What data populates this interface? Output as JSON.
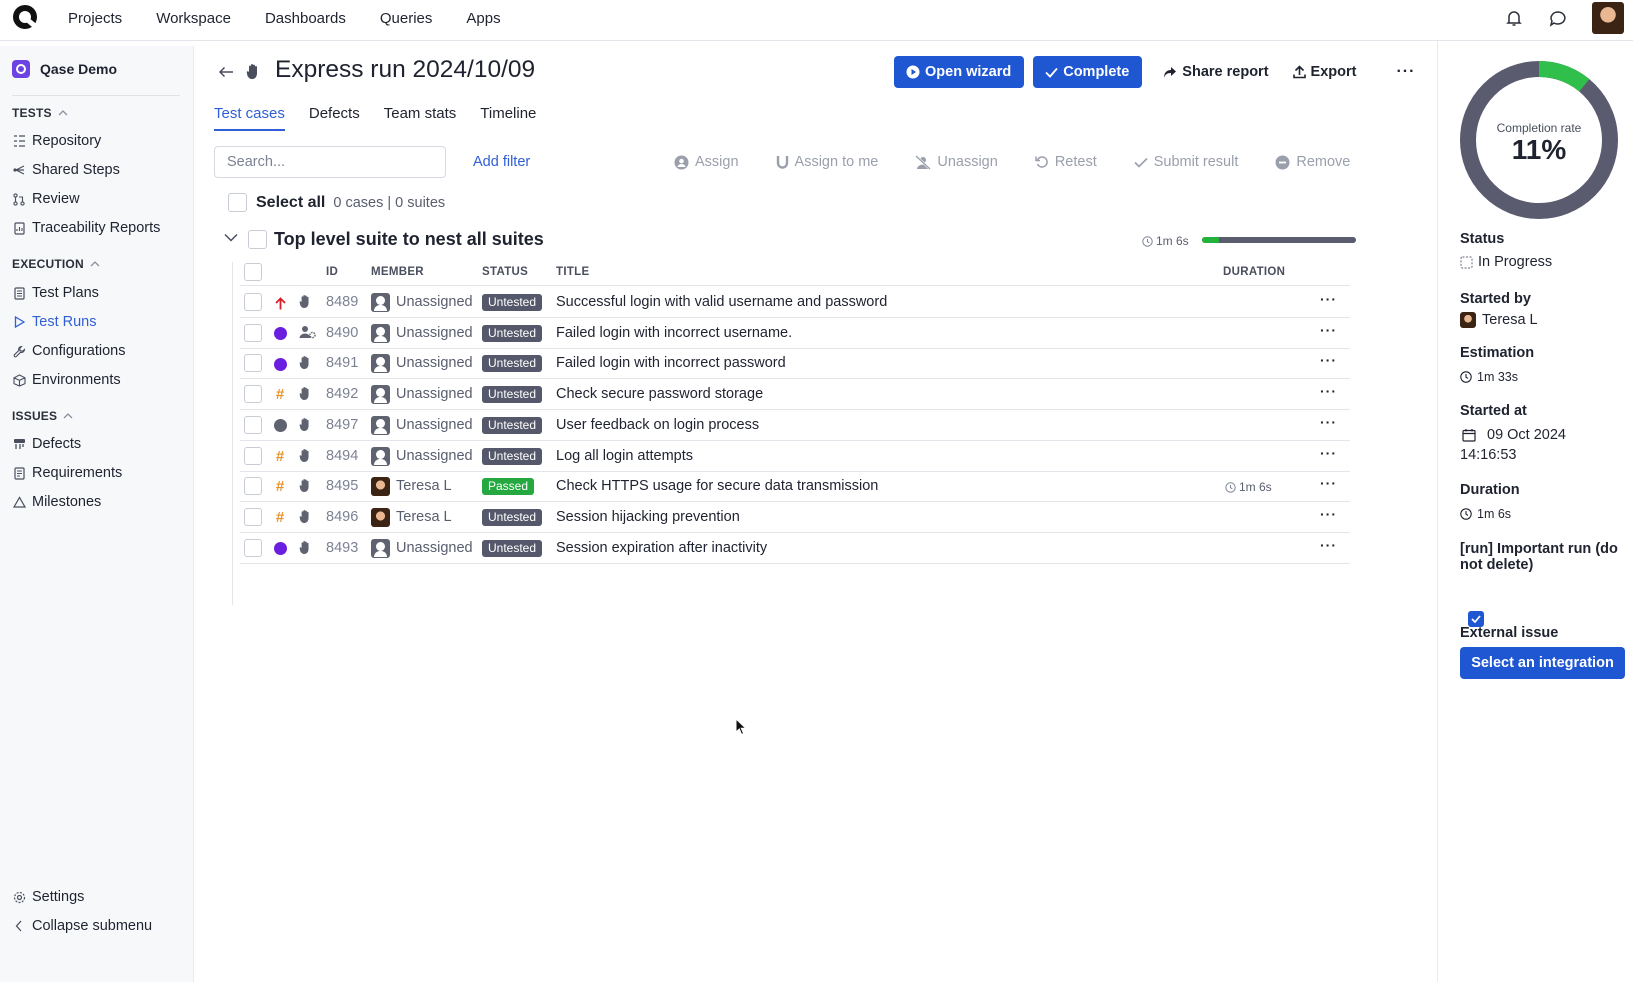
{
  "topnav": {
    "items": [
      "Projects",
      "Workspace",
      "Dashboards",
      "Queries",
      "Apps"
    ]
  },
  "sidebar": {
    "project": "Qase Demo",
    "sections": {
      "tests": {
        "label": "TESTS",
        "items": [
          "Repository",
          "Shared Steps",
          "Review",
          "Traceability Reports"
        ]
      },
      "execution": {
        "label": "EXECUTION",
        "items": [
          "Test Plans",
          "Test Runs",
          "Configurations",
          "Environments"
        ]
      },
      "issues": {
        "label": "ISSUES",
        "items": [
          "Defects",
          "Requirements",
          "Milestones"
        ]
      }
    },
    "footer": {
      "settings": "Settings",
      "collapse": "Collapse submenu"
    }
  },
  "run": {
    "title": "Express run 2024/10/09",
    "actions": {
      "open_wizard": "Open wizard",
      "complete": "Complete",
      "share": "Share report",
      "export": "Export",
      "more": "···"
    },
    "tabs": [
      "Test cases",
      "Defects",
      "Team stats",
      "Timeline"
    ],
    "search_placeholder": "Search...",
    "add_filter": "Add filter",
    "bulk": [
      "Assign",
      "Assign to me",
      "Unassign",
      "Retest",
      "Submit result",
      "Remove"
    ],
    "select_all": "Select all",
    "select_counts": "0 cases | 0 suites",
    "suite": {
      "title": "Top level suite to nest all suites",
      "duration": "1m 6s",
      "progress": 0.11
    },
    "columns": {
      "id": "ID",
      "member": "MEMBER",
      "status": "STATUS",
      "title": "TITLE",
      "duration": "DURATION"
    },
    "rows": [
      {
        "priority": "high-arrow",
        "type": "hand",
        "id": "8489",
        "member": "Unassigned",
        "status": "Untested",
        "title": "Successful login with valid username and password",
        "duration": ""
      },
      {
        "priority": "purple-dot",
        "type": "automated",
        "id": "8490",
        "member": "Unassigned",
        "status": "Untested",
        "title": "Failed login with incorrect username.",
        "duration": ""
      },
      {
        "priority": "purple-dot",
        "type": "hand",
        "id": "8491",
        "member": "Unassigned",
        "status": "Untested",
        "title": "Failed login with incorrect password",
        "duration": ""
      },
      {
        "priority": "hash",
        "type": "hand",
        "id": "8492",
        "member": "Unassigned",
        "status": "Untested",
        "title": "Check secure password storage",
        "duration": ""
      },
      {
        "priority": "gray-dot",
        "type": "hand",
        "id": "8497",
        "member": "Unassigned",
        "status": "Untested",
        "title": "User feedback on login process",
        "duration": ""
      },
      {
        "priority": "hash",
        "type": "hand",
        "id": "8494",
        "member": "Unassigned",
        "status": "Untested",
        "title": "Log all login attempts",
        "duration": ""
      },
      {
        "priority": "hash",
        "type": "hand",
        "id": "8495",
        "member": "Teresa L",
        "status": "Passed",
        "title": "Check HTTPS usage for secure data transmission",
        "duration": "1m 6s"
      },
      {
        "priority": "hash",
        "type": "hand",
        "id": "8496",
        "member": "Teresa L",
        "status": "Untested",
        "title": "Session hijacking prevention",
        "duration": ""
      },
      {
        "priority": "purple-dot",
        "type": "hand",
        "id": "8493",
        "member": "Unassigned",
        "status": "Untested",
        "title": "Session expiration after inactivity",
        "duration": ""
      }
    ]
  },
  "panel": {
    "completion_caption": "Completion rate",
    "completion_value": "11%",
    "completion_fraction": 0.11,
    "status_label": "Status",
    "status_value": "In Progress",
    "started_by_label": "Started by",
    "started_by_value": "Teresa L",
    "estimation_label": "Estimation",
    "estimation_value": "1m 33s",
    "started_at_label": "Started at",
    "started_at_date": "09 Oct 2024",
    "started_at_time": "14:16:53",
    "duration_label": "Duration",
    "duration_value": "1m 6s",
    "custom_field_label": "[run] Important run (do not delete)",
    "custom_field_checked": true,
    "external_issue_label": "External issue",
    "integration_button": "Select an integration"
  },
  "colors": {
    "primary": "#1f57d3",
    "link": "#2f5ed6",
    "passed": "#25a83f",
    "untested": "#55586a",
    "progress_track": "#595b6f",
    "progress_fill": "#23b33d"
  }
}
